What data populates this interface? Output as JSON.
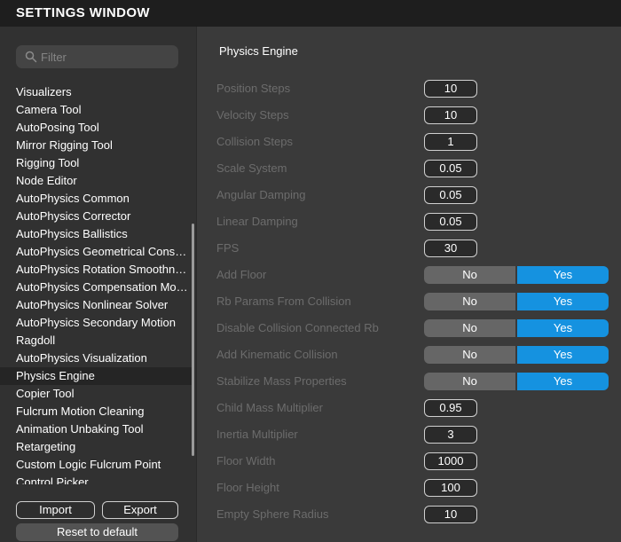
{
  "window": {
    "title": "SETTINGS WINDOW"
  },
  "sidebar": {
    "filter_placeholder": "Filter",
    "items": [
      {
        "label": "Visualizers"
      },
      {
        "label": "Camera Tool"
      },
      {
        "label": "AutoPosing Tool"
      },
      {
        "label": "Mirror Rigging Tool"
      },
      {
        "label": "Rigging Tool"
      },
      {
        "label": "Node Editor"
      },
      {
        "label": "AutoPhysics Common"
      },
      {
        "label": "AutoPhysics Corrector"
      },
      {
        "label": "AutoPhysics Ballistics"
      },
      {
        "label": "AutoPhysics Geometrical Constr..."
      },
      {
        "label": "AutoPhysics Rotation Smoothness"
      },
      {
        "label": "AutoPhysics Compensation Moti..."
      },
      {
        "label": "AutoPhysics Nonlinear Solver"
      },
      {
        "label": "AutoPhysics Secondary Motion"
      },
      {
        "label": "Ragdoll"
      },
      {
        "label": "AutoPhysics Visualization"
      },
      {
        "label": "Physics Engine"
      },
      {
        "label": "Copier Tool"
      },
      {
        "label": "Fulcrum Motion Cleaning"
      },
      {
        "label": "Animation Unbaking Tool"
      },
      {
        "label": "Retargeting"
      },
      {
        "label": "Custom Logic Fulcrum Point"
      },
      {
        "label": "Control Picker"
      }
    ],
    "active_index": 16,
    "import_label": "Import",
    "export_label": "Export",
    "reset_label": "Reset to default"
  },
  "main": {
    "section_title": "Physics Engine",
    "rows": [
      {
        "label": "Position Steps",
        "type": "number",
        "value": "10"
      },
      {
        "label": "Velocity Steps",
        "type": "number",
        "value": "10"
      },
      {
        "label": "Collision Steps",
        "type": "number",
        "value": "1"
      },
      {
        "label": "Scale System",
        "type": "number",
        "value": "0.05"
      },
      {
        "label": "Angular Damping",
        "type": "number",
        "value": "0.05"
      },
      {
        "label": "Linear Damping",
        "type": "number",
        "value": "0.05"
      },
      {
        "label": "FPS",
        "type": "number",
        "value": "30"
      },
      {
        "label": "Add Floor",
        "type": "toggle",
        "no": "No",
        "yes": "Yes",
        "selected": "Yes"
      },
      {
        "label": "Rb Params From Collision",
        "type": "toggle",
        "no": "No",
        "yes": "Yes",
        "selected": "Yes"
      },
      {
        "label": "Disable Collision Connected Rb",
        "type": "toggle",
        "no": "No",
        "yes": "Yes",
        "selected": "Yes"
      },
      {
        "label": "Add Kinematic Collision",
        "type": "toggle",
        "no": "No",
        "yes": "Yes",
        "selected": "Yes"
      },
      {
        "label": "Stabilize Mass Properties",
        "type": "toggle",
        "no": "No",
        "yes": "Yes",
        "selected": "Yes"
      },
      {
        "label": "Child Mass Multiplier",
        "type": "number",
        "value": "0.95"
      },
      {
        "label": "Inertia Multiplier",
        "type": "number",
        "value": "3"
      },
      {
        "label": "Floor Width",
        "type": "number",
        "value": "1000"
      },
      {
        "label": "Floor Height",
        "type": "number",
        "value": "100"
      },
      {
        "label": "Empty Sphere Radius",
        "type": "number",
        "value": "10"
      }
    ]
  },
  "colors": {
    "accent": "#1592e0",
    "toggle_off": "#666666",
    "disabled_label": "#6c6c6c"
  }
}
